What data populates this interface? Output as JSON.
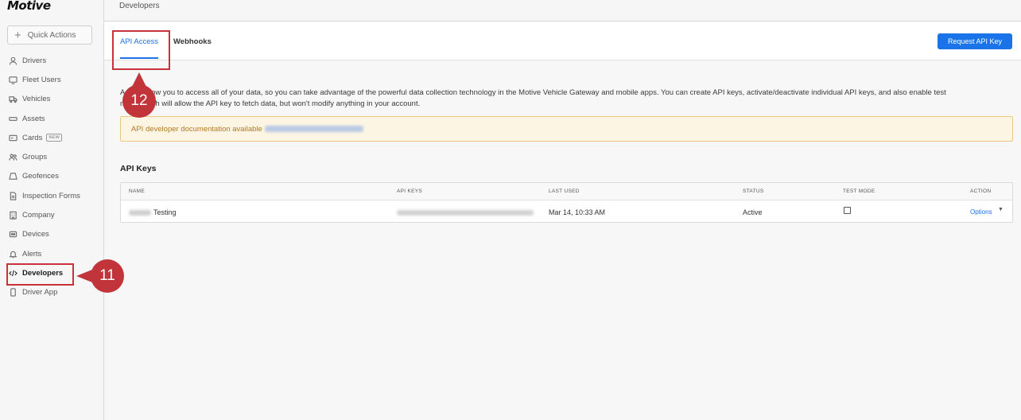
{
  "app": {
    "logo": "Motive"
  },
  "sidebar": {
    "quick_actions": "Quick Actions",
    "items": [
      {
        "label": "Drivers",
        "icon": "person-icon"
      },
      {
        "label": "Fleet Users",
        "icon": "monitor-icon"
      },
      {
        "label": "Vehicles",
        "icon": "truck-icon"
      },
      {
        "label": "Assets",
        "icon": "trailer-icon"
      },
      {
        "label": "Cards",
        "icon": "card-icon",
        "badge": "NEW"
      },
      {
        "label": "Groups",
        "icon": "groups-icon"
      },
      {
        "label": "Geofences",
        "icon": "geofence-icon"
      },
      {
        "label": "Inspection Forms",
        "icon": "document-icon"
      },
      {
        "label": "Company",
        "icon": "building-icon"
      },
      {
        "label": "Devices",
        "icon": "device-icon"
      },
      {
        "label": "Alerts",
        "icon": "bell-icon"
      },
      {
        "label": "Developers",
        "icon": "code-icon",
        "active": true
      },
      {
        "label": "Driver App",
        "icon": "phone-icon"
      }
    ]
  },
  "header": {
    "breadcrumb": "Developers"
  },
  "tabs": [
    {
      "label": "API Access",
      "active": true
    },
    {
      "label": "Webhooks",
      "active": false
    }
  ],
  "request_button": "Request API Key",
  "description_line1": "A         allow you to access all of your data, so you can take advantage of the powerful data collection technology in the Motive Vehicle Gateway and mobile apps. You can create API keys, activate/deactivate individual API keys, and also enable test",
  "description_line2": "m            ch will allow the API key to fetch data, but won't modify anything in your account.",
  "banner": {
    "text": "API developer documentation available"
  },
  "api_keys": {
    "title": "API Keys",
    "columns": [
      "NAME",
      "API KEYS",
      "LAST USED",
      "STATUS",
      "TEST MODE",
      "ACTION"
    ],
    "rows": [
      {
        "name": "Testing",
        "last_used": "Mar 14, 10:33 AM",
        "status": "Active",
        "test_mode": false,
        "action": "Options"
      }
    ]
  },
  "callouts": [
    "11",
    "12"
  ],
  "colors": {
    "accent": "#1a73e8",
    "highlight": "#c9323a",
    "banner_bg": "#fdf5e4"
  }
}
